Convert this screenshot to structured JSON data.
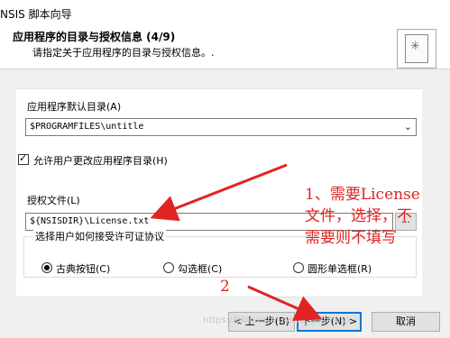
{
  "window": {
    "title": "NSIS 脚本向导"
  },
  "header": {
    "title": "应用程序的目录与授权信息 (4/9)",
    "subtitle": "请指定关于应用程序的目录与授权信息。."
  },
  "dir": {
    "label": "应用程序默认目录(A)",
    "value": "$PROGRAMFILES\\untitle"
  },
  "allow_change": {
    "label": "允许用户更改应用程序目录(H)",
    "checked": true
  },
  "license": {
    "label": "授权文件(L)",
    "value": "${NSISDIR}\\License.txt",
    "browse": "..."
  },
  "accept_group": {
    "label": "选择用户如何接受许可证协议",
    "options": [
      "古典按钮(C)",
      "勾选框(C)",
      "圆形单选框(R)"
    ],
    "selected": 0
  },
  "buttons": {
    "back": "< 上一步(B)",
    "next": "下一步(N) >",
    "cancel": "取消"
  },
  "annotations": {
    "note1": [
      "1、需要License",
      "文件，选择，不",
      "需要则不填写"
    ],
    "note2": "2"
  },
  "watermark": "https://blog.csdn.net/u_galphnux",
  "colors": {
    "annotation": "#e02424",
    "default_button_border": "#0078d7"
  }
}
